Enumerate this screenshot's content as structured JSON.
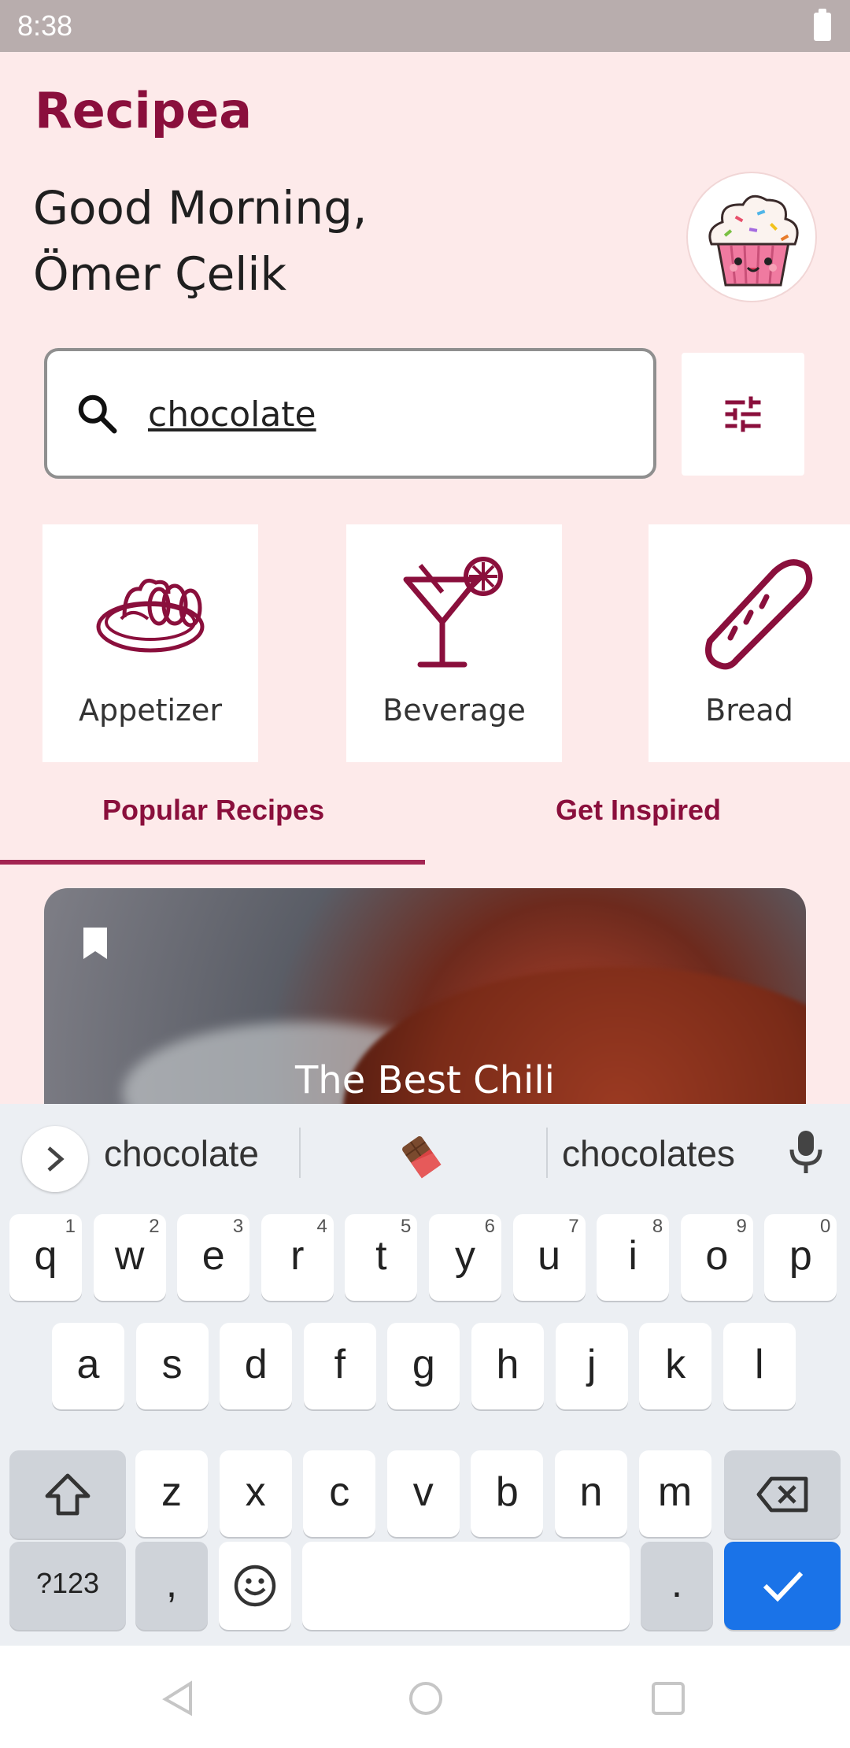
{
  "status_bar": {
    "time": "8:38"
  },
  "app": {
    "title": "Recipea"
  },
  "greeting": {
    "line1": "Good Morning,",
    "line2": "Ömer Çelik"
  },
  "search": {
    "value": "chocolate"
  },
  "categories": [
    {
      "label": "Appetizer",
      "icon": "appetizer-icon"
    },
    {
      "label": "Beverage",
      "icon": "cocktail-icon"
    },
    {
      "label": "Bread",
      "icon": "bread-icon"
    }
  ],
  "tabs": [
    {
      "label": "Popular Recipes",
      "selected": true
    },
    {
      "label": "Get Inspired",
      "selected": false
    }
  ],
  "recipe_card": {
    "title": "The Best Chili"
  },
  "keyboard": {
    "suggestions": [
      "chocolate",
      "chocolates"
    ],
    "row1": [
      {
        "k": "q",
        "h": "1"
      },
      {
        "k": "w",
        "h": "2"
      },
      {
        "k": "e",
        "h": "3"
      },
      {
        "k": "r",
        "h": "4"
      },
      {
        "k": "t",
        "h": "5"
      },
      {
        "k": "y",
        "h": "6"
      },
      {
        "k": "u",
        "h": "7"
      },
      {
        "k": "i",
        "h": "8"
      },
      {
        "k": "o",
        "h": "9"
      },
      {
        "k": "p",
        "h": "0"
      }
    ],
    "row2": [
      "a",
      "s",
      "d",
      "f",
      "g",
      "h",
      "j",
      "k",
      "l"
    ],
    "row3": [
      "z",
      "x",
      "c",
      "v",
      "b",
      "n",
      "m"
    ],
    "symbols_label": "?123",
    "comma_label": ",",
    "period_label": "."
  },
  "colors": {
    "accent": "#8a0f3c",
    "background": "#fdeaea",
    "keyboard_action": "#1a73e8"
  }
}
